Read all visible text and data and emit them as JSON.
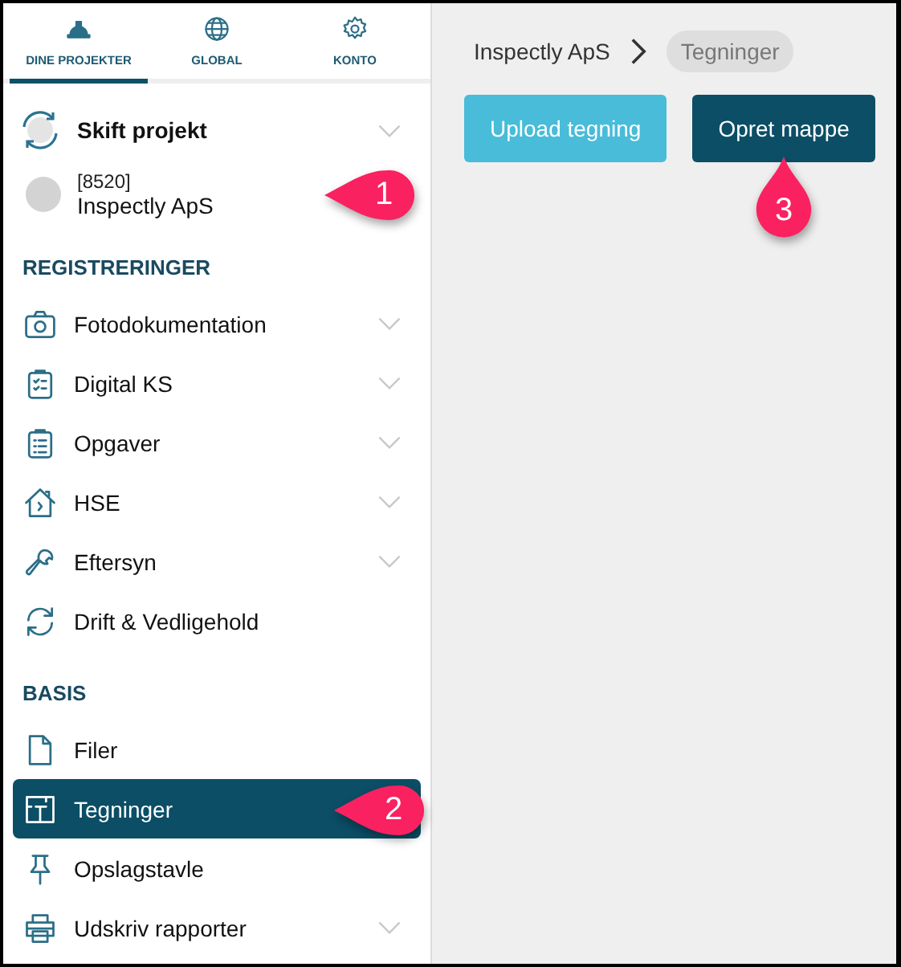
{
  "tabs": [
    {
      "label": "DINE PROJEKTER",
      "kind": "helmet",
      "selected": true
    },
    {
      "label": "GLOBAL",
      "kind": "globe",
      "selected": false
    },
    {
      "label": "KONTO",
      "kind": "gear",
      "selected": false
    }
  ],
  "project_switch": {
    "label": "Skift projekt",
    "expandable": true
  },
  "current_project": {
    "number": "[8520]",
    "name": "Inspectly ApS",
    "callout": "1"
  },
  "sections": [
    {
      "title": "REGISTRERINGER",
      "items": [
        {
          "label": "Fotodokumentation",
          "kind": "camera",
          "expandable": true,
          "selected": false
        },
        {
          "label": "Digital KS",
          "kind": "clipboard-check",
          "expandable": true,
          "selected": false
        },
        {
          "label": "Opgaver",
          "kind": "clipboard-list",
          "expandable": true,
          "selected": false
        },
        {
          "label": "HSE",
          "kind": "house",
          "expandable": true,
          "selected": false
        },
        {
          "label": "Eftersyn",
          "kind": "wrench",
          "expandable": true,
          "selected": false
        },
        {
          "label": "Drift & Vedligehold",
          "kind": "sync",
          "expandable": false,
          "selected": false
        }
      ]
    },
    {
      "title": "BASIS",
      "items": [
        {
          "label": "Filer",
          "kind": "file",
          "expandable": false,
          "selected": false
        },
        {
          "label": "Tegninger",
          "kind": "floorplan",
          "expandable": false,
          "selected": true,
          "callout": "2"
        },
        {
          "label": "Opslagstavle",
          "kind": "pin",
          "expandable": false,
          "selected": false
        },
        {
          "label": "Udskriv rapporter",
          "kind": "printer",
          "expandable": true,
          "selected": false
        }
      ]
    }
  ],
  "breadcrumb": [
    {
      "label": "Inspectly ApS",
      "current": false
    },
    {
      "label": "Tegninger",
      "current": true
    }
  ],
  "buttons": [
    {
      "label": "Upload tegning",
      "kind": "secondary"
    },
    {
      "label": "Opret mappe",
      "kind": "primary",
      "callout": "3"
    }
  ]
}
